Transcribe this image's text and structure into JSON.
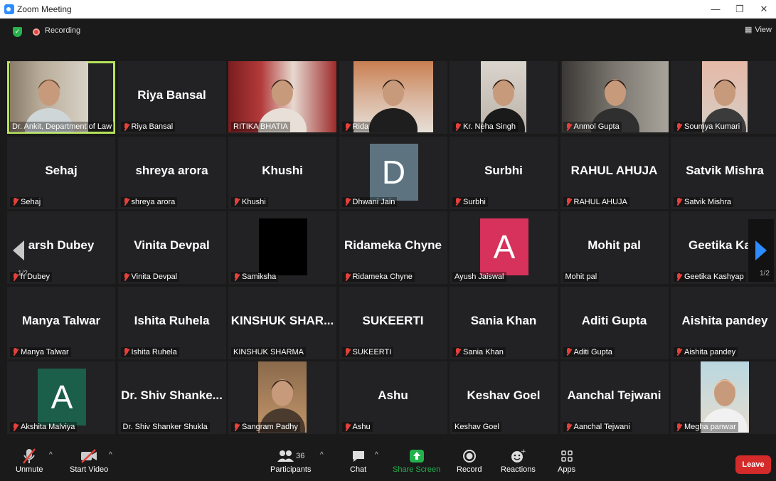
{
  "window": {
    "title": "Zoom Meeting",
    "controls": [
      "—",
      "❐",
      "✕"
    ]
  },
  "topbar": {
    "recording_label": "Recording",
    "view_label": "View"
  },
  "pagination": {
    "left": "1/2",
    "right": "1/2"
  },
  "tiles": [
    {
      "big": "",
      "footer": "Dr. Ankit, Department of Law",
      "muted": false,
      "active": true,
      "photo": "ankit"
    },
    {
      "big": "Riya Bansal",
      "footer": "Riya Bansal",
      "muted": true
    },
    {
      "big": "",
      "footer": "RITIKA BHATIA",
      "muted": false,
      "photo": "ritika"
    },
    {
      "big": "",
      "footer": "Rida",
      "muted": true,
      "photo": "rida"
    },
    {
      "big": "",
      "footer": "Kr. Neha Singh",
      "muted": true,
      "photo": "neha"
    },
    {
      "big": "",
      "footer": "Anmol Gupta",
      "muted": true,
      "photo": "anmol"
    },
    {
      "big": "",
      "footer": "Soumya Kumari",
      "muted": true,
      "photo": "soumya"
    },
    {
      "big": "Sehaj",
      "footer": "Sehaj",
      "muted": true
    },
    {
      "big": "shreya arora",
      "footer": "shreya arora",
      "muted": true
    },
    {
      "big": "Khushi",
      "footer": "Khushi",
      "muted": true
    },
    {
      "big": "",
      "footer": "Dhwani Jain",
      "muted": true,
      "avatar": "D",
      "avatar_color": "#5d7480"
    },
    {
      "big": "Surbhi",
      "footer": "Surbhi",
      "muted": true
    },
    {
      "big": "RAHUL AHUJA",
      "footer": "RAHUL AHUJA",
      "muted": true
    },
    {
      "big": "Satvik Mishra",
      "footer": "Satvik Mishra",
      "muted": true
    },
    {
      "big": "arsh Dubey",
      "footer": "h Dubey",
      "muted": true
    },
    {
      "big": "Vinita Devpal",
      "footer": "Vinita Devpal",
      "muted": true
    },
    {
      "big": "",
      "footer": "Samiksha",
      "muted": true,
      "avatar": "",
      "avatar_color": "#000000"
    },
    {
      "big": "Ridameka Chyne",
      "footer": "Ridameka Chyne",
      "muted": true
    },
    {
      "big": "",
      "footer": "Ayush Jaiswal",
      "muted": false,
      "avatar": "A",
      "avatar_color": "#d6325b"
    },
    {
      "big": "Mohit pal",
      "footer": "Mohit pal",
      "muted": false
    },
    {
      "big": "Geetika Kasl",
      "footer": "Geetika Kashyap",
      "muted": true
    },
    {
      "big": "Manya Talwar",
      "footer": "Manya Talwar",
      "muted": true
    },
    {
      "big": "Ishita Ruhela",
      "footer": "Ishita Ruhela",
      "muted": true
    },
    {
      "big": "KINSHUK SHAR...",
      "footer": "KINSHUK SHARMA",
      "muted": false
    },
    {
      "big": "SUKEERTI",
      "footer": "SUKEERTI",
      "muted": true
    },
    {
      "big": "Sania Khan",
      "footer": "Sania Khan",
      "muted": true
    },
    {
      "big": "Aditi Gupta",
      "footer": "Aditi Gupta",
      "muted": true
    },
    {
      "big": "Aishita pandey",
      "footer": "Aishita pandey",
      "muted": true
    },
    {
      "big": "",
      "footer": "Akshita Malviya",
      "muted": true,
      "avatar": "A",
      "avatar_color": "#1b5e4a"
    },
    {
      "big": "Dr. Shiv Shanke...",
      "footer": "Dr. Shiv Shanker Shukla",
      "muted": false
    },
    {
      "big": "",
      "footer": "Sangram Padhy",
      "muted": true,
      "photo": "sangram"
    },
    {
      "big": "Ashu",
      "footer": "Ashu",
      "muted": true
    },
    {
      "big": "Keshav Goel",
      "footer": "Keshav Goel",
      "muted": false
    },
    {
      "big": "Aanchal Tejwani",
      "footer": "Aanchal Tejwani",
      "muted": true
    },
    {
      "big": "",
      "footer": "Megha panwar",
      "muted": true,
      "photo": "megha"
    }
  ],
  "toolbar": {
    "unmute": "Unmute",
    "start_video": "Start Video",
    "participants": "Participants",
    "participants_count": "36",
    "chat": "Chat",
    "share_screen": "Share Screen",
    "record": "Record",
    "reactions": "Reactions",
    "apps": "Apps",
    "leave": "Leave"
  },
  "colors": {
    "active_speaker": "#b6e35b",
    "share_green": "#23b14d",
    "leave_red": "#d42a2a"
  }
}
